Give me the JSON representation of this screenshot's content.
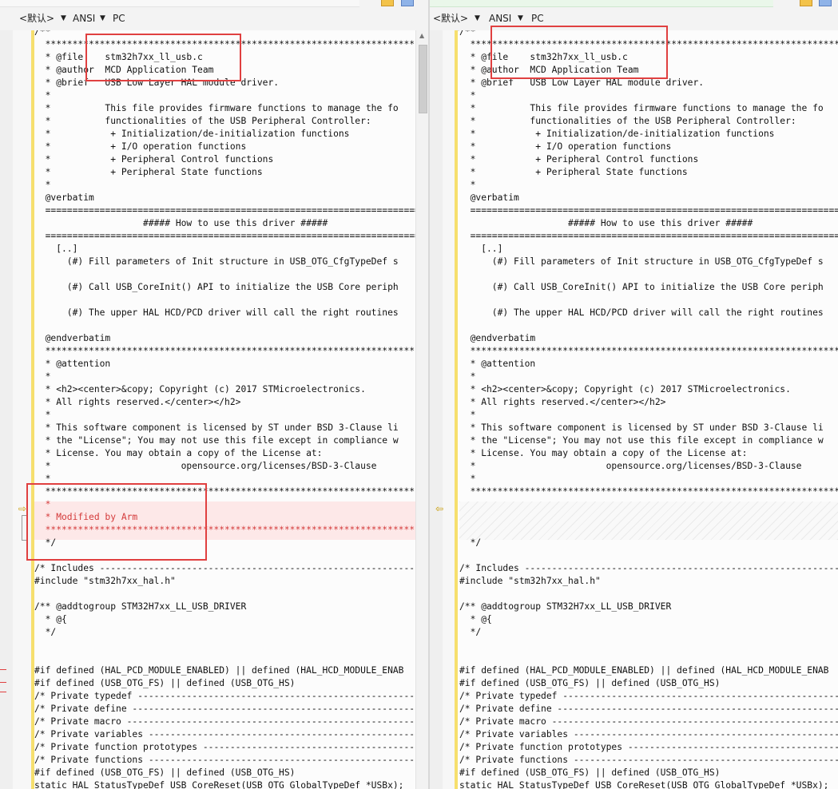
{
  "toolbar": {
    "encoding_left": "<默认>",
    "charset_left": "ANSI",
    "lineend_left": "PC",
    "encoding_right": "<默认>",
    "charset_right": "ANSI",
    "lineend_right": "PC",
    "arrow": "▼"
  },
  "colors": {
    "diff_removed_bg": "#fde8e8",
    "diff_removed_text": "#d43a3a",
    "highlight_box": "#e04040",
    "change_marker": "#f6df6e"
  },
  "icons": {
    "diff_arrow_left": "⇨",
    "diff_arrow_right": "⇦",
    "scroll_up": "▲"
  },
  "left": {
    "lines": [
      "/**",
      "  ******************************************************************************",
      "  * @file    stm32h7xx_ll_usb.c",
      "  * @author  MCD Application Team",
      "  * @brief   USB Low Layer HAL module driver.",
      "  *",
      "  *          This file provides firmware functions to manage the fo",
      "  *          functionalities of the USB Peripheral Controller:",
      "  *           + Initialization/de-initialization functions",
      "  *           + I/O operation functions",
      "  *           + Peripheral Control functions",
      "  *           + Peripheral State functions",
      "  *",
      "  @verbatim",
      "  ==============================================================================",
      "                    ##### How to use this driver #####",
      "  ==============================================================================",
      "    [..]",
      "      (#) Fill parameters of Init structure in USB_OTG_CfgTypeDef s",
      "",
      "      (#) Call USB_CoreInit() API to initialize the USB Core periph",
      "",
      "      (#) The upper HAL HCD/PCD driver will call the right routines",
      "",
      "  @endverbatim",
      "  ******************************************************************************",
      "  * @attention",
      "  *",
      "  * <h2><center>&copy; Copyright (c) 2017 STMicroelectronics.",
      "  * All rights reserved.</center></h2>",
      "  *",
      "  * This software component is licensed by ST under BSD 3-Clause li",
      "  * the \"License\"; You may not use this file except in compliance w",
      "  * License. You may obtain a copy of the License at:",
      "  *                        opensource.org/licenses/BSD-3-Clause",
      "  *",
      "  ******************************************************************************",
      "  *",
      "  * Modified by Arm",
      "  ******************************************************************************",
      "  */",
      "",
      "/* Includes ------------------------------------------------------------------",
      "#include \"stm32h7xx_hal.h\"",
      "",
      "/** @addtogroup STM32H7xx_LL_USB_DRIVER",
      "  * @{",
      "  */",
      "",
      "",
      "#if defined (HAL_PCD_MODULE_ENABLED) || defined (HAL_HCD_MODULE_ENAB",
      "#if defined (USB_OTG_FS) || defined (USB_OTG_HS)",
      "/* Private typedef -----------------------------------------------------------",
      "/* Private define ------------------------------------------------------------",
      "/* Private macro -------------------------------------------------------------",
      "/* Private variables ---------------------------------------------------------",
      "/* Private function prototypes -----------------------------------------------",
      "/* Private functions ---------------------------------------------------------",
      "#if defined (USB_OTG_FS) || defined (USB_OTG_HS)",
      "static HAL_StatusTypeDef USB_CoreReset(USB_OTG_GlobalTypeDef *USBx);"
    ]
  },
  "right": {
    "lines": [
      "/**",
      "  ******************************************************************************",
      "  * @file    stm32h7xx_ll_usb.c",
      "  * @author  MCD Application Team",
      "  * @brief   USB Low Layer HAL module driver.",
      "  *",
      "  *          This file provides firmware functions to manage the fo",
      "  *          functionalities of the USB Peripheral Controller:",
      "  *           + Initialization/de-initialization functions",
      "  *           + I/O operation functions",
      "  *           + Peripheral Control functions",
      "  *           + Peripheral State functions",
      "  *",
      "  @verbatim",
      "  ==============================================================================",
      "                    ##### How to use this driver #####",
      "  ==============================================================================",
      "    [..]",
      "      (#) Fill parameters of Init structure in USB_OTG_CfgTypeDef s",
      "",
      "      (#) Call USB_CoreInit() API to initialize the USB Core periph",
      "",
      "      (#) The upper HAL HCD/PCD driver will call the right routines",
      "",
      "  @endverbatim",
      "  ******************************************************************************",
      "  * @attention",
      "  *",
      "  * <h2><center>&copy; Copyright (c) 2017 STMicroelectronics.",
      "  * All rights reserved.</center></h2>",
      "  *",
      "  * This software component is licensed by ST under BSD 3-Clause li",
      "  * the \"License\"; You may not use this file except in compliance w",
      "  * License. You may obtain a copy of the License at:",
      "  *                        opensource.org/licenses/BSD-3-Clause",
      "  *",
      "  ******************************************************************************",
      "",
      "",
      "",
      "  */",
      "",
      "/* Includes ------------------------------------------------------------------",
      "#include \"stm32h7xx_hal.h\"",
      "",
      "/** @addtogroup STM32H7xx_LL_USB_DRIVER",
      "  * @{",
      "  */",
      "",
      "",
      "#if defined (HAL_PCD_MODULE_ENABLED) || defined (HAL_HCD_MODULE_ENAB",
      "#if defined (USB_OTG_FS) || defined (USB_OTG_HS)",
      "/* Private typedef -----------------------------------------------------------",
      "/* Private define ------------------------------------------------------------",
      "/* Private macro -------------------------------------------------------------",
      "/* Private variables ---------------------------------------------------------",
      "/* Private function prototypes -----------------------------------------------",
      "/* Private functions ---------------------------------------------------------",
      "#if defined (USB_OTG_FS) || defined (USB_OTG_HS)",
      "static HAL_StatusTypeDef USB_CoreReset(USB_OTG_GlobalTypeDef *USBx);"
    ]
  }
}
